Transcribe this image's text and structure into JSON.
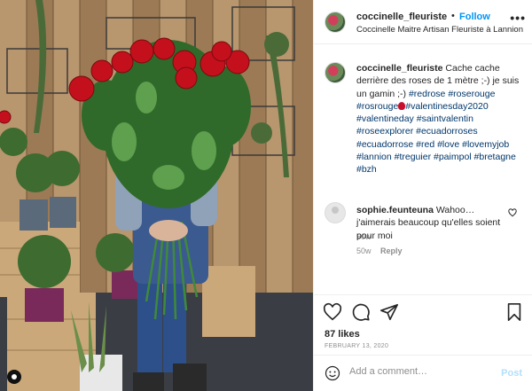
{
  "header": {
    "username": "coccinelle_fleuriste",
    "separator": "•",
    "follow_label": "Follow",
    "subtitle": "Coccinelle Maitre Artisan Fleuriste à Lannion",
    "more_icon": "more-horizontal-icon"
  },
  "caption": {
    "username": "coccinelle_fleuriste",
    "text": "Cache cache derrière des roses de 1 mètre ;-) je suis un gamin ;-)",
    "hashtags_a": [
      "#redrose",
      "#roserouge",
      "#rosrouge"
    ],
    "hashtags_b": [
      "#valentinesday2020",
      "#valentineday",
      "#saintvalentin",
      "#roseexplorer",
      "#ecuadorroses",
      "#ecuadorrose",
      "#red",
      "#love",
      "#lovemyjob",
      "#lannion",
      "#treguier",
      "#paimpol",
      "#bretagne",
      "#bzh"
    ],
    "emoji_icon": "rose-icon",
    "time": "50w"
  },
  "comment": {
    "username": "sophie.feunteuna",
    "text": "Wahoo… j'aimerais beaucoup qu'elles soient pour moi",
    "time": "50w",
    "reply_label": "Reply"
  },
  "actions": {
    "icons": [
      "heart-icon",
      "comment-icon",
      "share-icon",
      "bookmark-icon"
    ],
    "likes": "87 likes",
    "date": "FEBRUARY 13, 2020"
  },
  "add_comment": {
    "placeholder": "Add a comment…",
    "post_label": "Post"
  },
  "colors": {
    "accent": "#0095f6",
    "hashtag": "#00376b",
    "muted": "#8e8e8e",
    "post_disabled": "#b2dffc"
  }
}
